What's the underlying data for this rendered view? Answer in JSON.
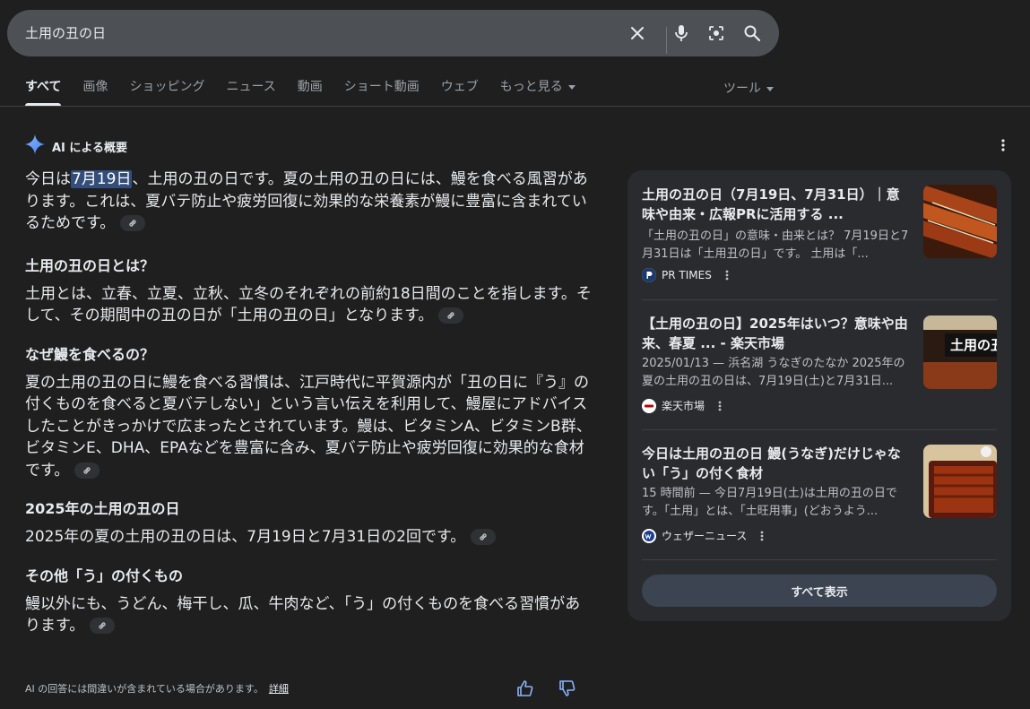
{
  "search": {
    "query": "土用の丑の日"
  },
  "tabs": [
    {
      "label": "すべて",
      "active": true
    },
    {
      "label": "画像"
    },
    {
      "label": "ショッピング"
    },
    {
      "label": "ニュース"
    },
    {
      "label": "動画"
    },
    {
      "label": "ショート動画"
    },
    {
      "label": "ウェブ"
    },
    {
      "label": "もっと見る"
    }
  ],
  "tools_label": "ツール",
  "ai": {
    "header": "AI による概要",
    "intro_before": "今日は",
    "intro_highlight": "7月19日",
    "intro_after": "、土用の丑の日です。夏の土用の丑の日には、鰻を食べる風習があります。これは、夏バテ防止や疲労回復に効果的な栄養素が鰻に豊富に含まれているためです。",
    "sections": [
      {
        "heading": "土用の丑の日とは？",
        "text": "土用とは、立春、立夏、立秋、立冬のそれぞれの前約18日間のことを指します。そして、その期間中の丑の日が「土用の丑の日」となります。"
      },
      {
        "heading": "なぜ鰻を食べるの？",
        "text": "夏の土用の丑の日に鰻を食べる習慣は、江戸時代に平賀源内が「丑の日に『う』の付くものを食べると夏バテしない」という言い伝えを利用して、鰻屋にアドバイスしたことがきっかけで広まったとされています。鰻は、ビタミンA、ビタミンB群、ビタミンE、DHA、EPAなどを豊富に含み、夏バテ防止や疲労回復に効果的な食材です。"
      },
      {
        "heading": "2025年の土用の丑の日",
        "text": "2025年の夏の土用の丑の日は、7月19日と7月31日の2回です。"
      },
      {
        "heading": "その他「う」の付くもの",
        "text": "鰻以外にも、うどん、梅干し、瓜、牛肉など、「う」の付くものを食べる習慣があります。"
      }
    ],
    "disclaimer": "AI の回答には間違いが含まれている場合があります。",
    "disclaimer_link": "詳細"
  },
  "sources": [
    {
      "title": "土用の丑の日（7月19日、7月31日）｜意味や由来・広報PRに活用する ...",
      "snippet": "「土用の丑の日」の意味・由来とは？ 7月19日と7月31日は「土用丑の日」です。 土用は「...",
      "source": "PR TIMES"
    },
    {
      "title": "【土用の丑の日】2025年はいつ？意味や由来、春夏 ... - 楽天市場",
      "snippet": "2025/01/13 — 浜名湖 うなぎのたなか 2025年の夏の土用の丑の日は、7月19日(土)と7月31日...",
      "source": "楽天市場",
      "image_text": "土用の丑"
    },
    {
      "title": "今日は土用の丑の日 鰻(うなぎ)だけじゃない「う」の付く食材",
      "snippet": "15 時間前 — 今日7月19日(土)は土用の丑の日です。「土用」とは、「土旺用事」(どおうよう...",
      "source": "ウェザーニュース"
    }
  ],
  "show_all": "すべて表示",
  "colors": {
    "background": "#1f1f1f",
    "panel": "#2a2b2f",
    "highlight": "#344e7a",
    "searchbar": "#4d5156"
  }
}
